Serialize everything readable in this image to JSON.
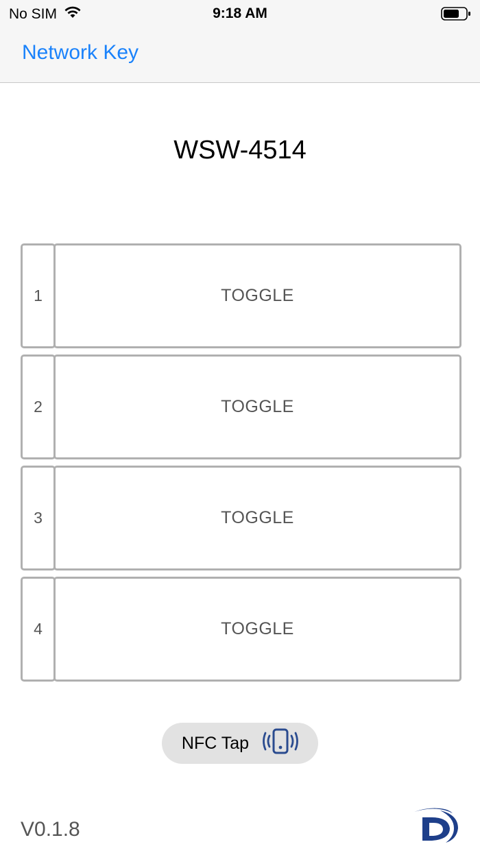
{
  "status_bar": {
    "carrier": "No SIM",
    "time": "9:18 AM",
    "icons": [
      "wifi-icon",
      "battery-icon"
    ]
  },
  "nav": {
    "back_label": "Network Key"
  },
  "device": {
    "title": "WSW-4514"
  },
  "switches": [
    {
      "number": "1",
      "label": "TOGGLE"
    },
    {
      "number": "2",
      "label": "TOGGLE"
    },
    {
      "number": "3",
      "label": "TOGGLE"
    },
    {
      "number": "4",
      "label": "TOGGLE"
    }
  ],
  "nfc": {
    "label": "NFC Tap",
    "icon": "phone-vibrate-icon"
  },
  "footer": {
    "version": "V0.1.8",
    "logo": "brand-logo"
  },
  "colors": {
    "accent": "#1a82fb",
    "border": "#b0b0b0",
    "nfc_icon": "#2a4b8f",
    "logo": "#1e3f8a"
  }
}
